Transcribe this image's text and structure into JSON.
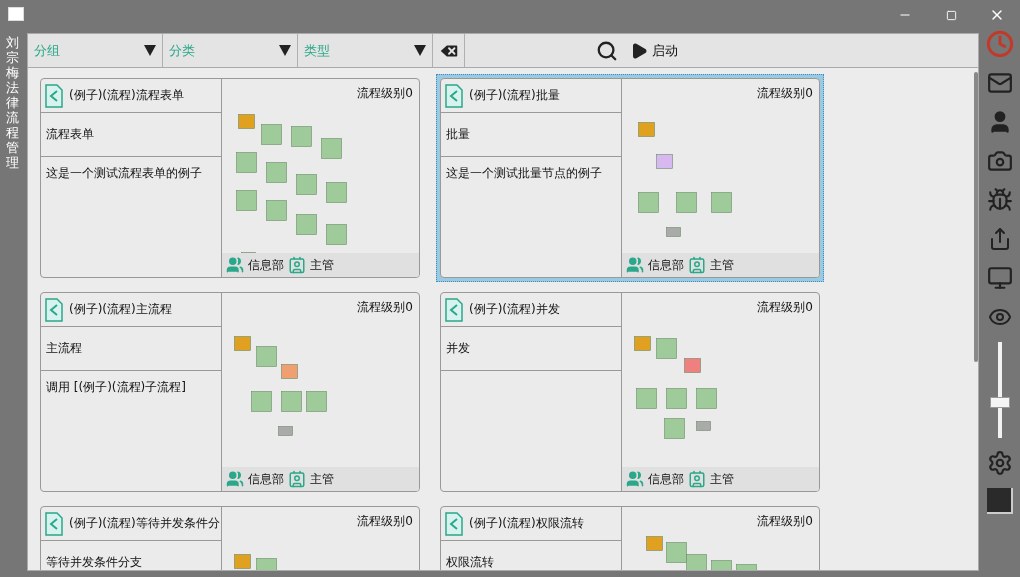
{
  "window": {
    "side_title": "刘宗梅法律流程管理"
  },
  "toolbar": {
    "filters": [
      {
        "label": "分组"
      },
      {
        "label": "分类"
      },
      {
        "label": "类型"
      }
    ],
    "start_button": "启动"
  },
  "cards": [
    {
      "title": "(例子)(流程)流程表单",
      "subtitle": "流程表单",
      "description": "这是一个测试流程表单的例子",
      "level_label": "流程级别0",
      "department": "信息部",
      "role": "主管",
      "selected": false
    },
    {
      "title": "(例子)(流程)批量",
      "subtitle": "批量",
      "description": "这是一个测试批量节点的例子",
      "level_label": "流程级别0",
      "department": "信息部",
      "role": "主管",
      "selected": true
    },
    {
      "title": "(例子)(流程)主流程",
      "subtitle": "主流程",
      "description": "调用 [(例子)(流程)子流程]",
      "level_label": "流程级别0",
      "department": "信息部",
      "role": "主管",
      "selected": false
    },
    {
      "title": "(例子)(流程)并发",
      "subtitle": "并发",
      "level_label": "流程级别0",
      "department": "信息部",
      "role": "主管",
      "selected": false
    },
    {
      "title": "(例子)(流程)等待并发条件分",
      "subtitle": "等待并发条件分支",
      "level_label": "流程级别0",
      "selected": false
    },
    {
      "title": "(例子)(流程)权限流转",
      "subtitle": "权限流转",
      "level_label": "流程级别0",
      "selected": false
    }
  ],
  "sidebar": {
    "zoom": {
      "level": 0.35
    }
  }
}
